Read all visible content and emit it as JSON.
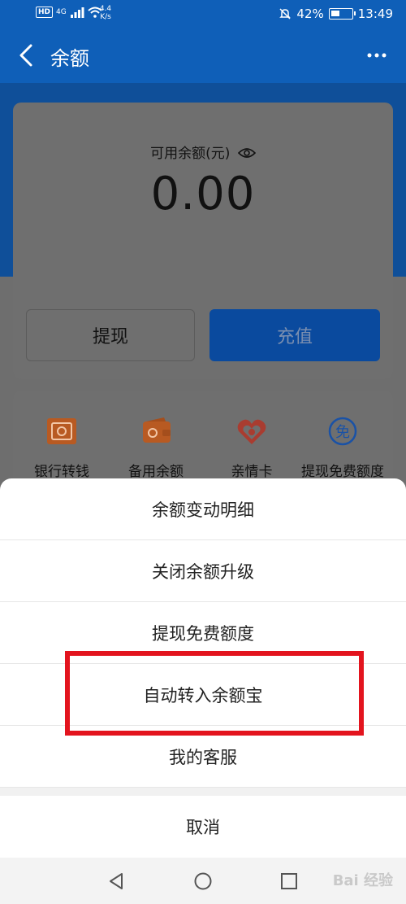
{
  "status_bar": {
    "hd": "HD",
    "network": "4G",
    "speed_value": "4.4",
    "speed_unit": "K/s",
    "battery": "42%",
    "battery_level": 0.42,
    "time": "13:49"
  },
  "header": {
    "title": "余额"
  },
  "balance": {
    "label": "可用余额(元)",
    "value": "0.00",
    "withdraw_label": "提现",
    "recharge_label": "充值"
  },
  "actions": [
    {
      "label": "银行转钱",
      "icon": "bank-transfer-icon",
      "color": "#f0641e"
    },
    {
      "label": "备用余额",
      "icon": "wallet-icon",
      "color": "#f0641e"
    },
    {
      "label": "亲情卡",
      "icon": "family-card-icon",
      "color": "#e84a3a"
    },
    {
      "label": "提现免费额度",
      "icon": "free-quota-icon",
      "color": "#1677ff"
    }
  ],
  "sheet": {
    "items": [
      "余额变动明细",
      "关闭余额升级",
      "提现免费额度",
      "自动转入余额宝",
      "我的客服"
    ],
    "cancel_label": "取消",
    "highlight_color": "#e3141e"
  },
  "watermark": "Bai 经验"
}
